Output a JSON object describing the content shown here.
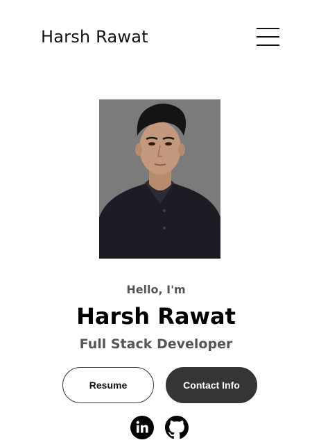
{
  "header": {
    "logo_text": "Harsh Rawat",
    "menu_icon": "hamburger-menu-icon"
  },
  "profile": {
    "photo_alt": "Profile picture",
    "greeting": "Hello, I'm",
    "name": "Harsh Rawat",
    "role": "Full Stack Developer"
  },
  "buttons": {
    "resume_label": "Resume",
    "contact_label": "Contact Info"
  },
  "socials": [
    {
      "icon": "linkedin-icon",
      "label": "LinkedIn"
    },
    {
      "icon": "github-icon",
      "label": "Github"
    }
  ],
  "colors": {
    "dark_button": "#353535",
    "photo_background": "#7a7a7a",
    "muted_text": "#555555"
  }
}
